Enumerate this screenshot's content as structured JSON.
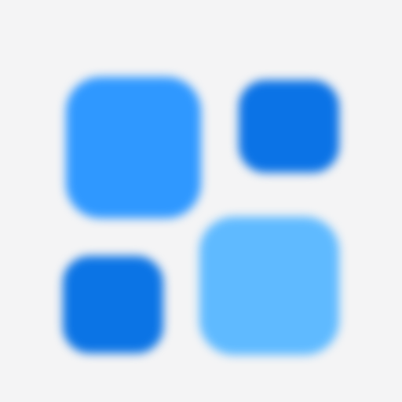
{
  "app_icon": {
    "icon_name": "four-tile-grid-icon",
    "background_color": "#f4f4f5",
    "tiles": [
      {
        "name": "large-top-left-tile",
        "color": "#2f98ff"
      },
      {
        "name": "small-top-right-tile",
        "color": "#0b73e6"
      },
      {
        "name": "small-bottom-left-tile",
        "color": "#0b74e5"
      },
      {
        "name": "large-bottom-right-tile",
        "color": "#5fbaff"
      }
    ]
  }
}
